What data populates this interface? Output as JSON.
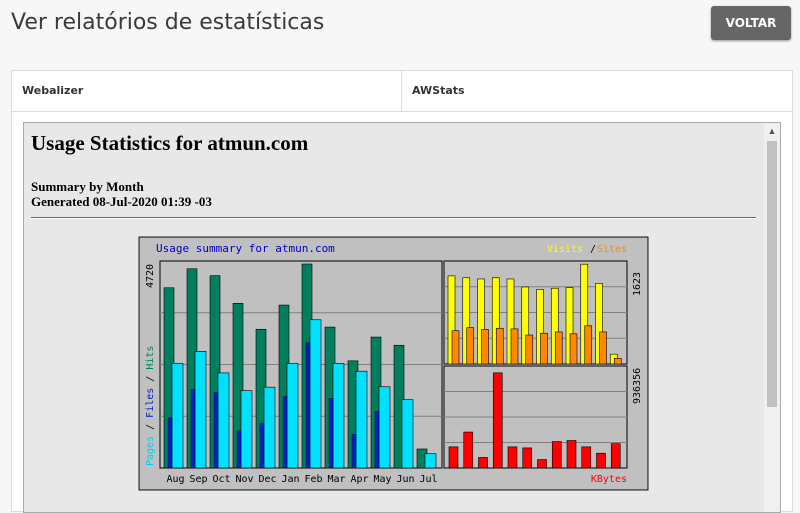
{
  "header": {
    "title": "Ver relatórios de estatísticas",
    "back_label": "VOLTAR"
  },
  "tabs": [
    {
      "label": "Webalizer"
    },
    {
      "label": "AWStats"
    }
  ],
  "report": {
    "title": "Usage Statistics for atmun.com",
    "summary_line1": "Summary by Month",
    "summary_line2": "Generated 08-Jul-2020 01:39 -03"
  },
  "chart_data": {
    "type": "bar",
    "title": "Usage summary for atmun.com",
    "categories": [
      "Aug",
      "Sep",
      "Oct",
      "Nov",
      "Dec",
      "Jan",
      "Feb",
      "Mar",
      "Apr",
      "May",
      "Jun",
      "Jul"
    ],
    "left_panel": {
      "ymax_label": "4720",
      "ymax": 4720,
      "axis_labels": [
        "Pages",
        "Files",
        "Hits"
      ],
      "series": [
        {
          "name": "Hits",
          "color": "#007f5f",
          "values": [
            4170,
            4610,
            4450,
            3810,
            3210,
            3770,
            4720,
            3260,
            2480,
            3030,
            2840,
            440
          ]
        },
        {
          "name": "Files",
          "color": "#00e0ff",
          "values": [
            2420,
            2700,
            2200,
            1790,
            1870,
            2420,
            3430,
            2420,
            2240,
            1880,
            1580,
            330
          ]
        },
        {
          "name": "Pages",
          "color": "#0022c0",
          "values": [
            1160,
            1820,
            1750,
            860,
            1030,
            1660,
            2900,
            1610,
            780,
            1310,
            0,
            0
          ]
        }
      ]
    },
    "right_top_panel": {
      "ymax_label": "1623",
      "ymax": 1623,
      "legend": [
        "Visits",
        "Sites"
      ],
      "series": [
        {
          "name": "Visits",
          "color": "#ffff00",
          "values": [
            1430,
            1400,
            1380,
            1400,
            1380,
            1250,
            1210,
            1230,
            1240,
            1620,
            1310,
            160
          ]
        },
        {
          "name": "Sites",
          "color": "#ff8800",
          "values": [
            540,
            590,
            560,
            580,
            570,
            470,
            500,
            520,
            490,
            620,
            520,
            90
          ]
        }
      ]
    },
    "right_bottom_panel": {
      "ymax_label": "936356",
      "ymax": 936356,
      "legend": [
        "KBytes"
      ],
      "series": [
        {
          "name": "KBytes",
          "color": "#ff0000",
          "values": [
            200000,
            340000,
            100000,
            900000,
            200000,
            190000,
            80000,
            250000,
            260000,
            200000,
            140000,
            230000
          ]
        }
      ]
    },
    "colors": {
      "background": "#c0c0c0",
      "title": "#0000c0"
    }
  }
}
